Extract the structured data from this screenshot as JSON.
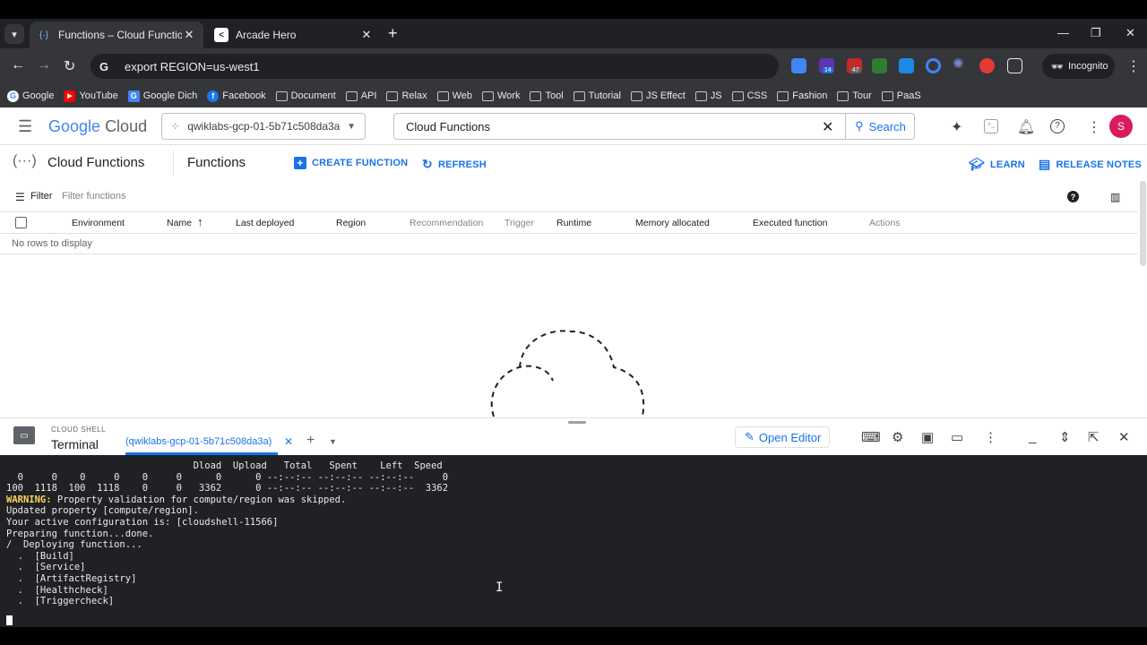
{
  "browser": {
    "tabs": [
      {
        "title": "Functions – Cloud Functions – c"
      },
      {
        "title": "Arcade Hero"
      }
    ],
    "address": "export REGION=us-west1",
    "profile": "Incognito",
    "ext_badges": [
      "14",
      "47"
    ],
    "bookmarks": [
      "Google",
      "YouTube",
      "Google Dich",
      "Facebook",
      "Document",
      "API",
      "Relax",
      "Web",
      "Work",
      "Tool",
      "Tutorial",
      "JS Effect",
      "JS",
      "CSS",
      "Fashion",
      "Tour",
      "PaaS"
    ]
  },
  "console": {
    "logo_google": "Google",
    "logo_cloud": "Cloud",
    "project": "qwiklabs-gcp-01-5b71c508da3a",
    "search_value": "Cloud Functions",
    "search_button": "Search",
    "avatar_letter": "S",
    "product": "Cloud Functions",
    "page_title": "Functions",
    "actions": {
      "create": "CREATE FUNCTION",
      "refresh": "REFRESH",
      "learn": "LEARN",
      "release_notes": "RELEASE NOTES"
    },
    "filter_label": "Filter",
    "filter_placeholder": "Filter functions",
    "columns": [
      "Environment",
      "Name",
      "Last deployed",
      "Region",
      "Recommendation",
      "Trigger",
      "Runtime",
      "Memory allocated",
      "Executed function",
      "Actions"
    ],
    "empty_message": "No rows to display"
  },
  "shell": {
    "subtitle": "CLOUD SHELL",
    "title": "Terminal",
    "tab": "(qwiklabs-gcp-01-5b71c508da3a)",
    "open_editor": "Open Editor",
    "lines": [
      "                                 Dload  Upload   Total   Spent    Left  Speed",
      "  0     0    0     0    0     0      0      0 --:--:-- --:--:-- --:--:--     0",
      "100  1118  100  1118    0     0   3362      0 --:--:-- --:--:-- --:--:--  3362"
    ],
    "warning_label": "WARNING:",
    "warning_text": " Property validation for compute/region was skipped.",
    "lines2": [
      "Updated property [compute/region].",
      "Your active configuration is: [cloudshell-11566]",
      "Preparing function...done.",
      "/  Deploying function...",
      "  .  [Build]",
      "  .  [Service]",
      "  .  [ArtifactRegistry]",
      "  .  [Healthcheck]",
      "  .  [Triggercheck]"
    ]
  }
}
